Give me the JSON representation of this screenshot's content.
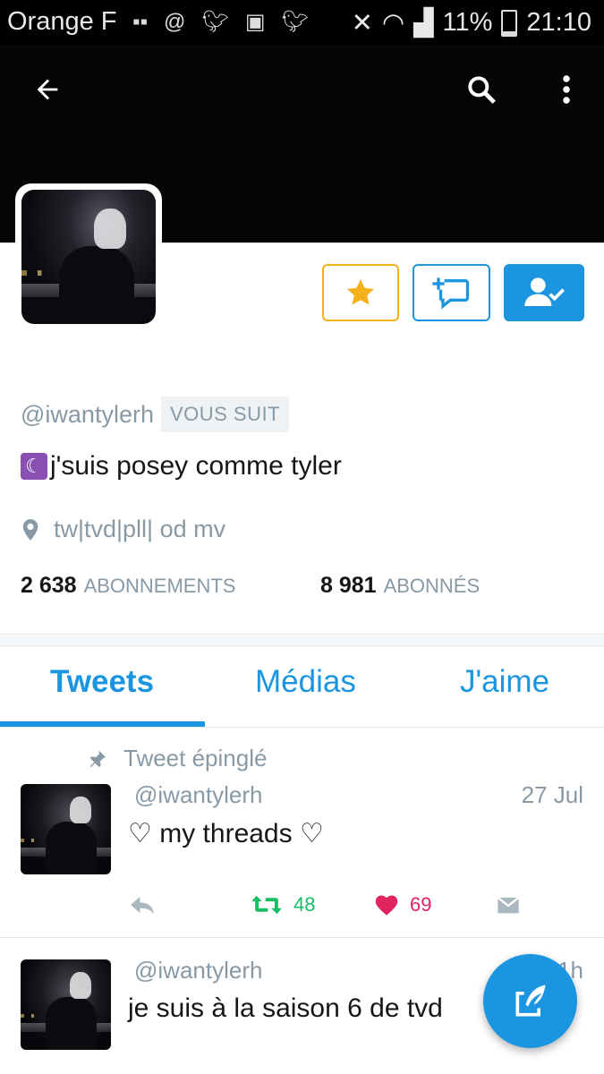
{
  "status_bar": {
    "carrier": "Orange F",
    "battery": "11%",
    "time": "21:10"
  },
  "profile": {
    "handle": "@iwantylerh",
    "follows_you": "VOUS SUIT",
    "bio_emoji": "☾",
    "bio": "j'suis posey comme tyler",
    "location": "tw|tvd|pll| od mv",
    "following_count": "2 638",
    "following_label": "ABONNEMENTS",
    "followers_count": "8 981",
    "followers_label": "ABONNÉS"
  },
  "tabs": [
    "Tweets",
    "Médias",
    "J'aime"
  ],
  "active_tab": "Tweets",
  "tweets": [
    {
      "pinned_label": "Tweet épinglé",
      "handle": "@iwantylerh",
      "date": "27 Jul",
      "text": "♡ my threads ♡",
      "retweets": "48",
      "likes": "69"
    },
    {
      "handle": "@iwantylerh",
      "date": "1h",
      "text": "je suis à la saison 6 de tvd"
    }
  ],
  "colors": {
    "accent": "#1b95e0",
    "star": "#f5b11b",
    "retweet": "#17bf63",
    "like": "#e0245e",
    "muted": "#8899a6"
  }
}
